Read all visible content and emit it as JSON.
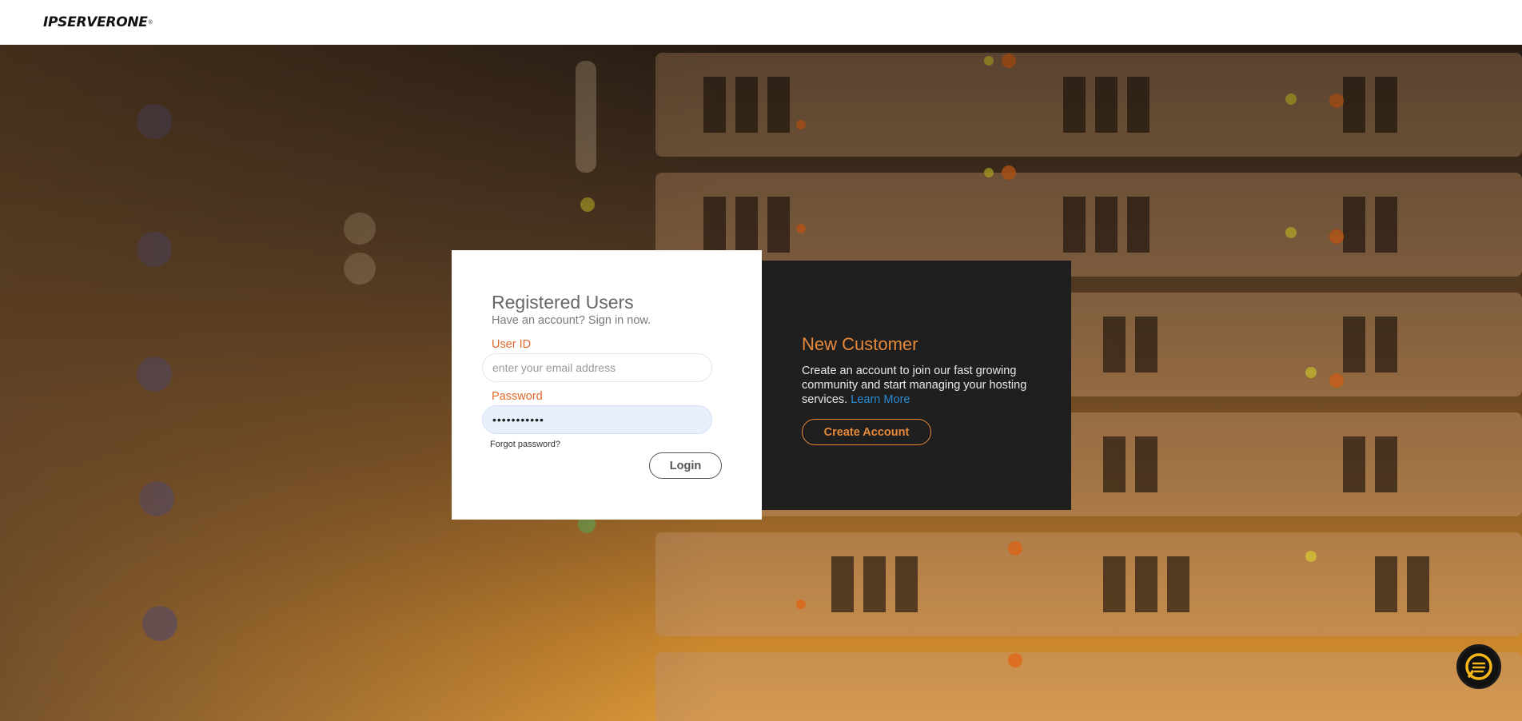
{
  "brand": {
    "logo_text": "IPSERVERONE",
    "logo_mark": "®"
  },
  "login": {
    "title": "Registered Users",
    "subtitle": "Have an account? Sign in now.",
    "user_label": "User ID",
    "user_placeholder": "enter your email address",
    "user_value": "",
    "password_label": "Password",
    "password_value": "•••••••••••",
    "forgot_label": "Forgot password?",
    "login_label": "Login"
  },
  "new_customer": {
    "title": "New Customer",
    "description": "Create an account to join our fast growing community and start managing your hosting services.",
    "learn_more_label": "Learn More",
    "create_label": "Create Account"
  },
  "chat": {
    "icon": "chat-icon"
  },
  "colors": {
    "accent_orange": "#e8893a",
    "label_orange": "#e0692a",
    "link_blue": "#2a8bd0",
    "dark_panel": "#1f1f1f",
    "chat_yellow": "#f5b61a"
  }
}
